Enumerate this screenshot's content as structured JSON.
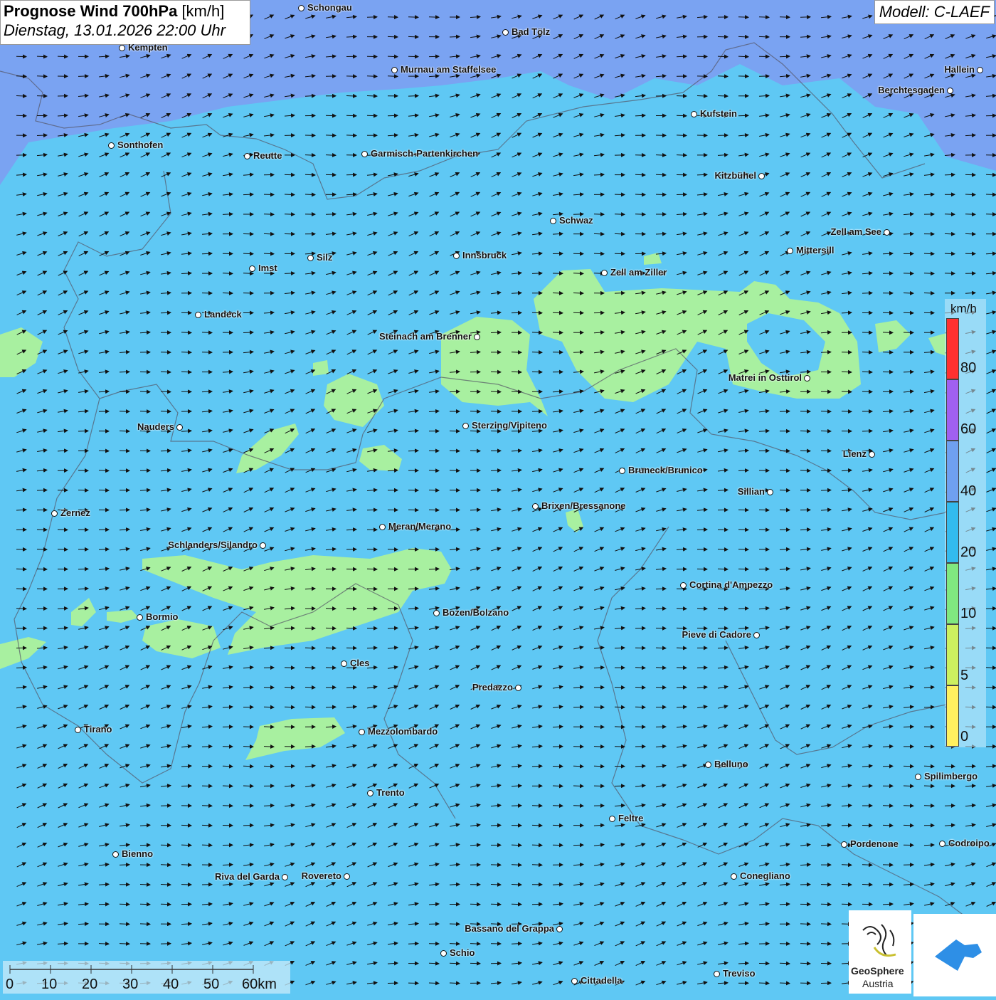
{
  "header": {
    "title_bold": "Prognose Wind 700hPa",
    "title_unit": "[km/h]",
    "datetime": "Dienstag, 13.01.2026 22:00 Uhr",
    "model": "Modell: C-LAEF"
  },
  "colors": {
    "base": "#5fc8f4",
    "band_20_40": "#6fa0f0",
    "band_10_20": "#a8f0a0",
    "north_band": "#7aa3f2"
  },
  "cities": [
    {
      "name": "Schongau",
      "key": "schongau"
    },
    {
      "name": "Bad Tölz",
      "key": "bad-toelz"
    },
    {
      "name": "Kempten",
      "key": "kempten"
    },
    {
      "name": "Murnau am Staffelsee",
      "key": "murnau"
    },
    {
      "name": "Hallein",
      "key": "hallein"
    },
    {
      "name": "Berchtesgaden",
      "key": "berchtesgaden"
    },
    {
      "name": "Kufstein",
      "key": "kufstein"
    },
    {
      "name": "Sonthofen",
      "key": "sonthofen"
    },
    {
      "name": "Reutte",
      "key": "reutte"
    },
    {
      "name": "Garmisch-Partenkirchen",
      "key": "garmisch"
    },
    {
      "name": "Kitzbühel",
      "key": "kitzbuehel"
    },
    {
      "name": "Schwaz",
      "key": "schwaz"
    },
    {
      "name": "Zell am See",
      "key": "zell-am-see"
    },
    {
      "name": "Mittersill",
      "key": "mittersill"
    },
    {
      "name": "Innsbruck",
      "key": "innsbruck"
    },
    {
      "name": "Imst",
      "key": "imst"
    },
    {
      "name": "Silz",
      "key": "silz"
    },
    {
      "name": "Zell am Ziller",
      "key": "zell-am-ziller"
    },
    {
      "name": "Landeck",
      "key": "landeck"
    },
    {
      "name": "Steinach am Brenner",
      "key": "steinach"
    },
    {
      "name": "Matrei in Osttirol",
      "key": "matrei"
    },
    {
      "name": "Nauders",
      "key": "nauders"
    },
    {
      "name": "Sterzing/Vipiteno",
      "key": "sterzing"
    },
    {
      "name": "Lienz",
      "key": "lienz"
    },
    {
      "name": "Bruneck/Brunico",
      "key": "bruneck"
    },
    {
      "name": "Sillian",
      "key": "sillian"
    },
    {
      "name": "Zernez",
      "key": "zernez"
    },
    {
      "name": "Brixen/Bressanone",
      "key": "brixen"
    },
    {
      "name": "Meran/Merano",
      "key": "meran"
    },
    {
      "name": "Schlanders/Silandro",
      "key": "schlanders"
    },
    {
      "name": "Cortina d'Ampezzo",
      "key": "cortina"
    },
    {
      "name": "Bozen/Bolzano",
      "key": "bozen"
    },
    {
      "name": "Bormio",
      "key": "bormio"
    },
    {
      "name": "Pieve di Cadore",
      "key": "pieve"
    },
    {
      "name": "Cles",
      "key": "cles"
    },
    {
      "name": "Predazzo",
      "key": "predazzo"
    },
    {
      "name": "Tirano",
      "key": "tirano"
    },
    {
      "name": "Mezzolombardo",
      "key": "mezzolombardo"
    },
    {
      "name": "Belluno",
      "key": "belluno"
    },
    {
      "name": "Spilimbergo",
      "key": "spilimbergo"
    },
    {
      "name": "Trento",
      "key": "trento"
    },
    {
      "name": "Feltre",
      "key": "feltre"
    },
    {
      "name": "Pordenone",
      "key": "pordenone"
    },
    {
      "name": "Codroipo",
      "key": "codroipo"
    },
    {
      "name": "Bienno",
      "key": "bienno"
    },
    {
      "name": "Riva del Garda",
      "key": "riva"
    },
    {
      "name": "Rovereto",
      "key": "rovereto"
    },
    {
      "name": "Conegliano",
      "key": "conegliano"
    },
    {
      "name": "Bassano del Grappa",
      "key": "bassano"
    },
    {
      "name": "Schio",
      "key": "schio"
    },
    {
      "name": "Treviso",
      "key": "treviso"
    },
    {
      "name": "Cittadella",
      "key": "cittadella"
    }
  ],
  "legend": {
    "unit": "km/h",
    "ticks": [
      "80",
      "60",
      "40",
      "20",
      "10",
      "5",
      "0"
    ],
    "colors": [
      "#ff3030",
      "#a060f0",
      "#6fa0f0",
      "#33bbee",
      "#80e880",
      "#ccf060",
      "#fff060"
    ]
  },
  "scalebar": {
    "labels": [
      "0",
      "10",
      "20",
      "30",
      "40",
      "50",
      "60km"
    ]
  },
  "logos": {
    "geosphere_line1": "GeoSphere",
    "geosphere_line2": "Austria"
  }
}
